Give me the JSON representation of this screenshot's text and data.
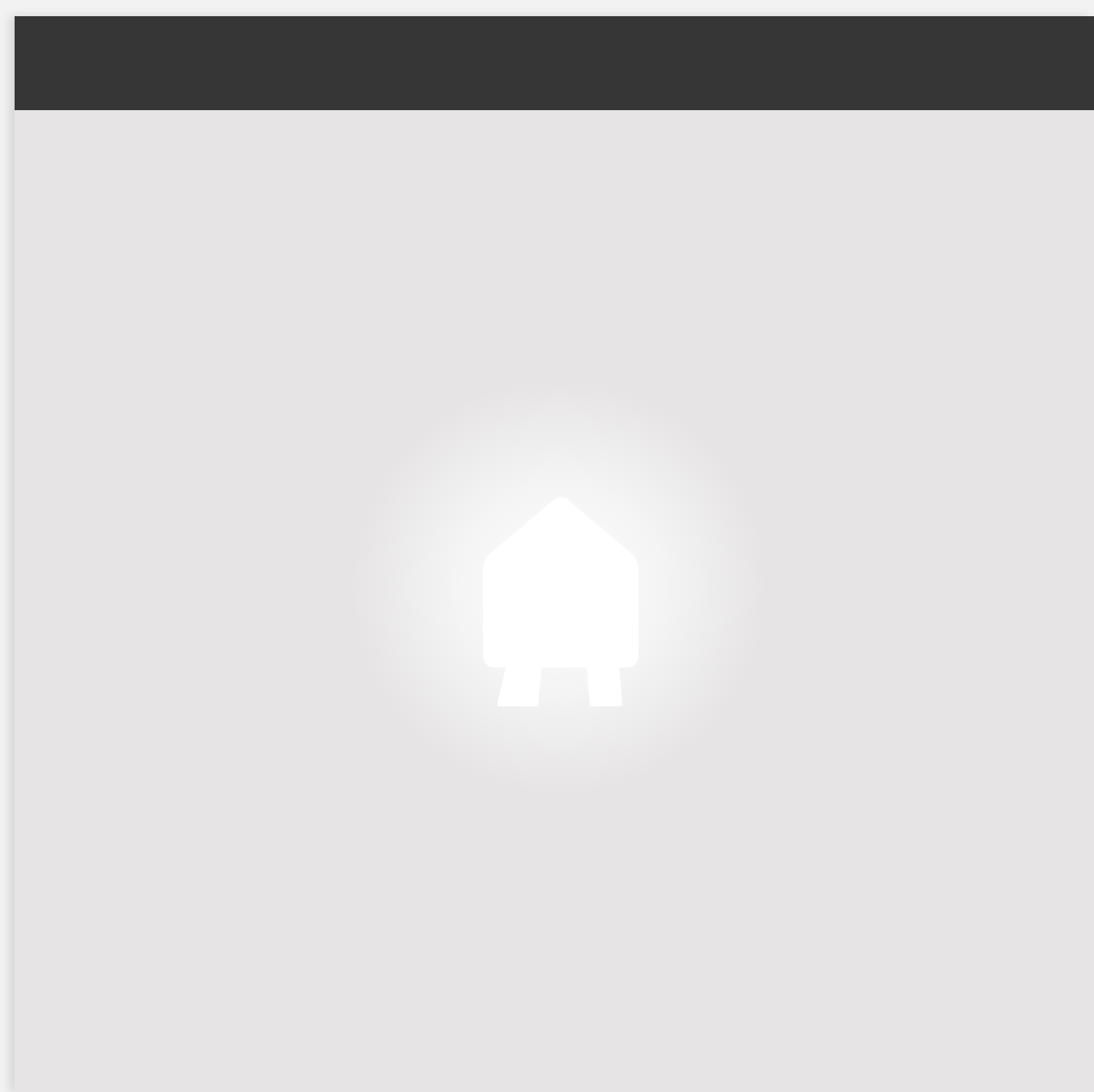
{
  "screen": {
    "kind": "splash"
  }
}
